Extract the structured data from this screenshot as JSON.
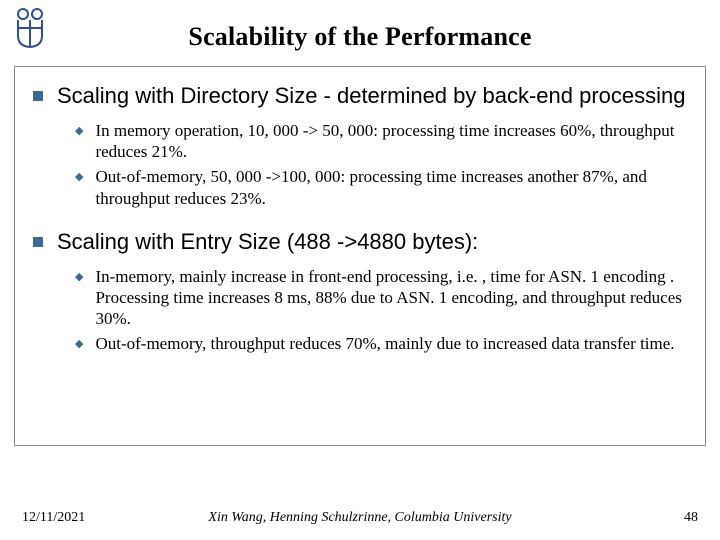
{
  "title": "Scalability of the Performance",
  "sections": [
    {
      "heading": "Scaling with Directory Size - determined by back-end processing",
      "items": [
        "In memory operation, 10, 000 -> 50, 000: processing time increases 60%, throughput reduces 21%.",
        "Out-of-memory, 50, 000 ->100, 000: processing time increases another 87%, and throughput reduces 23%."
      ]
    },
    {
      "heading": "Scaling with Entry Size (488 ->4880 bytes):",
      "items": [
        "In-memory, mainly increase in front-end processing, i.e. , time for ASN. 1 encoding . Processing time  increases 8 ms, 88% due to ASN. 1 encoding, and throughput  reduces 30%.",
        "Out-of-memory, throughput reduces 70%, mainly due to increased data transfer time."
      ]
    }
  ],
  "footer": {
    "date": "12/11/2021",
    "authors": "Xin Wang, Henning Schulzrinne, Columbia University",
    "page": "48"
  },
  "logo_color": "#2a4fa3"
}
